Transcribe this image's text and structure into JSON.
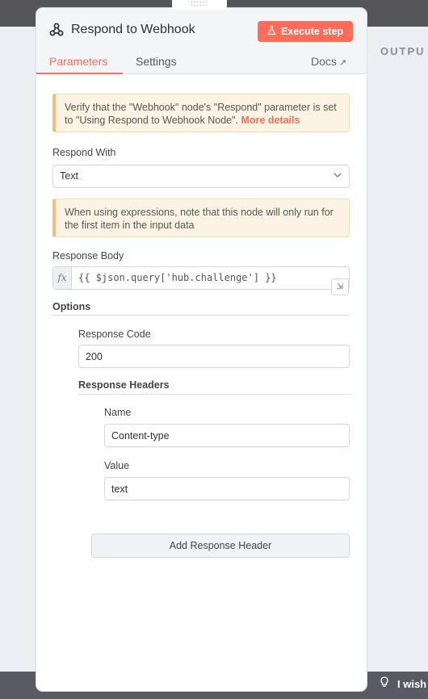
{
  "background": {
    "output_label": "OUTPU",
    "feedback_text": "I wish t"
  },
  "node": {
    "title": "Respond to Webhook",
    "icon": "webhook-icon",
    "execute_label": "Execute step"
  },
  "tabs": [
    {
      "label": "Parameters",
      "active": true
    },
    {
      "label": "Settings",
      "active": false
    }
  ],
  "docs_label": "Docs",
  "notice_webhook": {
    "text": "Verify that the \"Webhook\" node's \"Respond\" parameter is set to \"Using Respond to Webhook Node\". ",
    "link": "More details"
  },
  "respond_with": {
    "label": "Respond With",
    "value": "Text"
  },
  "notice_expressions": {
    "text": "When using expressions, note that this node will only run for the first item in the input data"
  },
  "response_body": {
    "label": "Response Body",
    "fx": "fx",
    "value": "{{ $json.query['hub.challenge'] }}"
  },
  "options": {
    "title": "Options",
    "response_code": {
      "label": "Response Code",
      "value": "200"
    },
    "response_headers": {
      "title": "Response Headers",
      "name": {
        "label": "Name",
        "value": "Content-type"
      },
      "value": {
        "label": "Value",
        "value": "text"
      },
      "add_label": "Add Response Header"
    }
  },
  "colors": {
    "accent": "#ff6d5a",
    "notice_bg": "#fdf3e4",
    "notice_border": "#f3c07b"
  }
}
